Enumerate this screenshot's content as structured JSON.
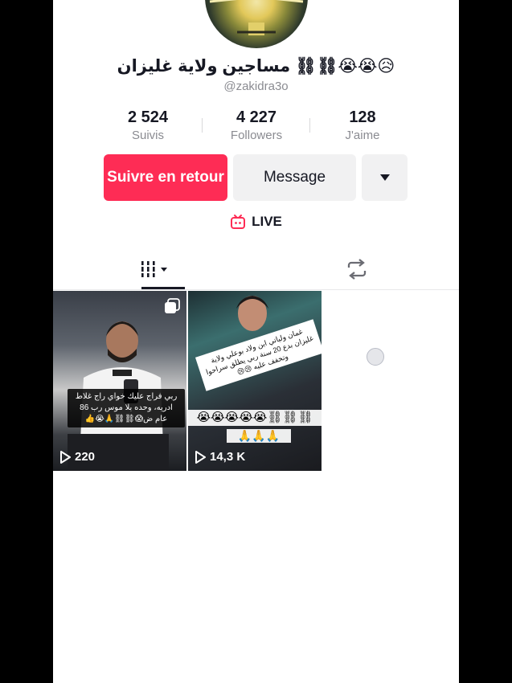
{
  "profile": {
    "display_name": "مساجين ولاية غليزان ⛓⛓😭😭😥",
    "handle": "@zakidra3o"
  },
  "stats": [
    {
      "value": "2 524",
      "label": "Suivis"
    },
    {
      "value": "4 227",
      "label": "Followers"
    },
    {
      "value": "128",
      "label": "J'aime"
    }
  ],
  "actions": {
    "follow_back_label": "Suivre en retour",
    "message_label": "Message"
  },
  "live": {
    "label": "LIVE"
  },
  "tabs": [
    {
      "name": "videos-tab",
      "icon": "grid-bars-icon",
      "active": true
    },
    {
      "name": "reposts-tab",
      "icon": "repost-icon",
      "active": false
    }
  ],
  "videos": [
    {
      "views": "220",
      "caption_line1": "ربي فراج عليك خواي راج غلاط",
      "caption_line2": "ادريه، وحده بلا موس رب 86",
      "caption_line3": "عام ض😱⛓⛓🙏😭👍",
      "multi_photo": true
    },
    {
      "views": "14,3 K",
      "caption": "غمان ولياتي ابن ولاد بوعلي ولاية غليزان بدع 20 سنة ربي يطلق سراحوا وتخفف عليه 😢😢",
      "emoji_line": "😭😭😭😭😭⛓⛓⛓",
      "hands_line": "🙏🙏🙏",
      "multi_photo": false
    }
  ],
  "colors": {
    "accent": "#fe2c55",
    "text_primary": "#161823",
    "text_secondary": "#8a8b91",
    "button_secondary_bg": "#f1f1f2"
  }
}
